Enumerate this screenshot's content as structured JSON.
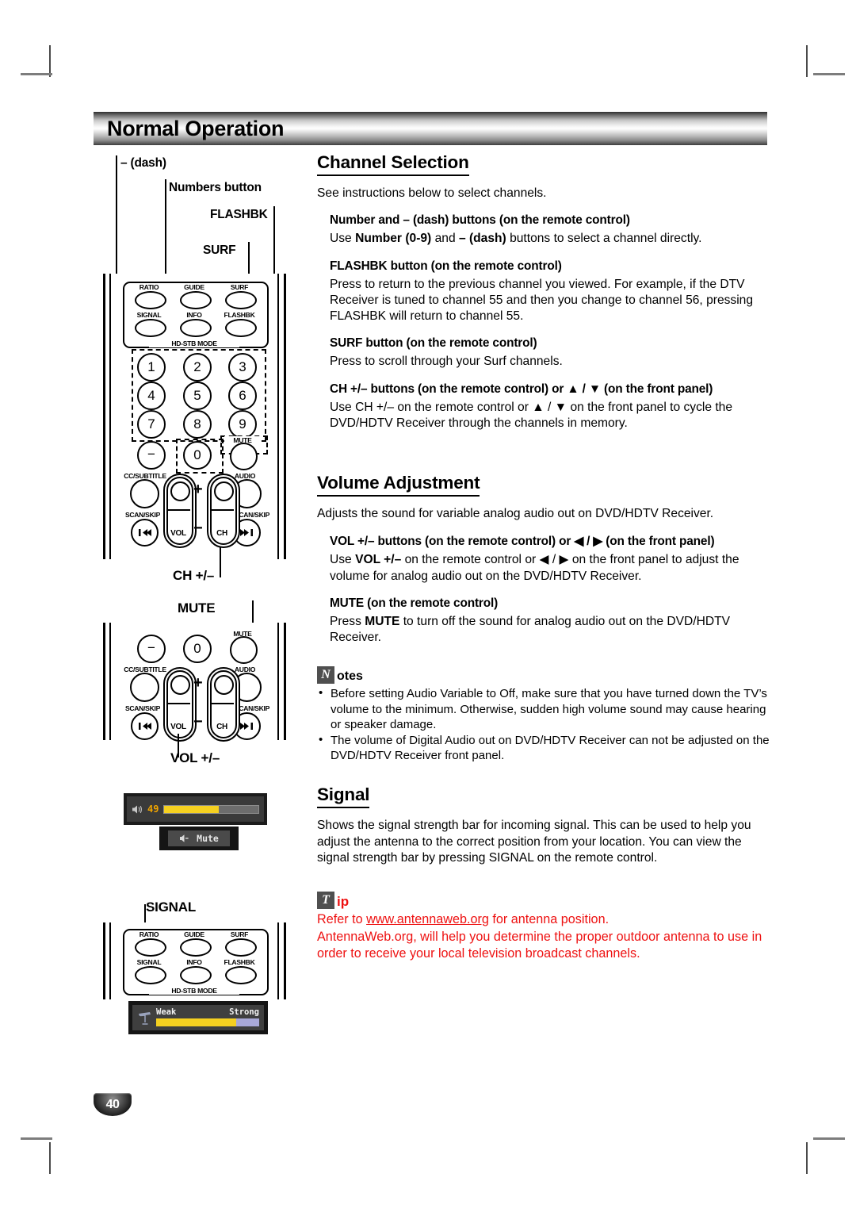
{
  "page": {
    "header_title": "Normal Operation",
    "page_number": "40"
  },
  "channel_selection": {
    "heading": "Channel Selection",
    "intro": "See instructions below to select channels.",
    "items": [
      {
        "head": "Number and – (dash) buttons (on the remote control)",
        "body": "Use Number (0-9) and – (dash) buttons to select a channel directly."
      },
      {
        "head": "FLASHBK button (on the remote control)",
        "body": "Press to return to the previous channel you viewed. For example, if the DTV Receiver is tuned to channel 55 and then you change to channel 56, pressing FLASHBK will return to channel 55."
      },
      {
        "head": "SURF button (on the remote control)",
        "body": "Press to scroll through your Surf channels."
      },
      {
        "head": "CH +/– buttons (on the remote control) or ▲ / ▼ (on the front panel)",
        "body": "Use CH +/– on the remote control or ▲ / ▼ on the front panel to cycle the DVD/HDTV Receiver through the channels in memory."
      }
    ]
  },
  "volume_adjustment": {
    "heading": "Volume Adjustment",
    "intro": "Adjusts the sound for variable analog audio out on DVD/HDTV Receiver.",
    "items": [
      {
        "head": "VOL +/– buttons (on the remote control) or ◀ / ▶ (on the front panel)",
        "body": "Use VOL +/– on the remote control or ◀ / ▶ on the front panel to adjust the volume for analog audio out on the DVD/HDTV Receiver."
      },
      {
        "head": "MUTE (on the remote control)",
        "body": "Press MUTE to turn off the sound for analog audio out on the DVD/HDTV Receiver."
      }
    ],
    "notes_glyph": "N",
    "notes_word": "otes",
    "notes": [
      "Before setting Audio Variable to Off, make sure that you have turned down the TV’s volume to the minimum. Otherwise, sudden high volume sound may cause hearing or speaker damage.",
      "The volume of Digital Audio out on DVD/HDTV Receiver can not be adjusted on the DVD/HDTV Receiver front panel."
    ]
  },
  "signal": {
    "heading": "Signal",
    "intro": "Shows the signal strength bar for incoming signal. This can be used to help you adjust the antenna to the correct position from your location. You can view the signal strength bar by pressing SIGNAL on the remote control.",
    "tip_glyph": "T",
    "tip_word": "ip",
    "tip_line1_pre": "Refer to ",
    "tip_link": "www.antennaweb.org",
    "tip_line1_post": " for antenna position.",
    "tip_line2": "AntennaWeb.org, will help you determine the proper outdoor antenna to use in order to receive your local television broadcast channels."
  },
  "callouts": {
    "dash": "– (dash)",
    "numbers": "Numbers button",
    "flashbk": "FLASHBK",
    "surf": "SURF",
    "ch_plus_minus": "CH +/–",
    "mute": "MUTE",
    "vol_plus_minus": "VOL +/–",
    "signal": "SIGNAL"
  },
  "remote": {
    "top_buttons_row1": [
      "RATIO",
      "GUIDE",
      "SURF"
    ],
    "top_buttons_row2": [
      "SIGNAL",
      "INFO",
      "FLASHBK"
    ],
    "mode_label": "HD-STB MODE",
    "numbers": [
      "1",
      "2",
      "3",
      "4",
      "5",
      "6",
      "7",
      "8",
      "9"
    ],
    "dash_key": "−",
    "zero_key": "0",
    "mute_key_label": "MUTE",
    "cc_label": "CC/SUBTITLE",
    "audio_label": "AUDIO",
    "scan_skip_label": "SCAN/SKIP",
    "vol_label": "VOL",
    "ch_label": "CH",
    "plus_sign": "+",
    "minus_sign": "−",
    "skip_prev_glyph": "⏮",
    "skip_next_glyph": "⏭"
  },
  "osd": {
    "volume_value": "49",
    "volume_percent": 58,
    "mute_label": "Mute",
    "signal_weak_label": "Weak",
    "signal_strong_label": "Strong",
    "signal_percent": 78
  },
  "colors": {
    "tip_red": "#ee1111",
    "osd_yellow": "#f5d020",
    "osd_number": "#f0a500",
    "signal_track": "#a8a8d8"
  }
}
